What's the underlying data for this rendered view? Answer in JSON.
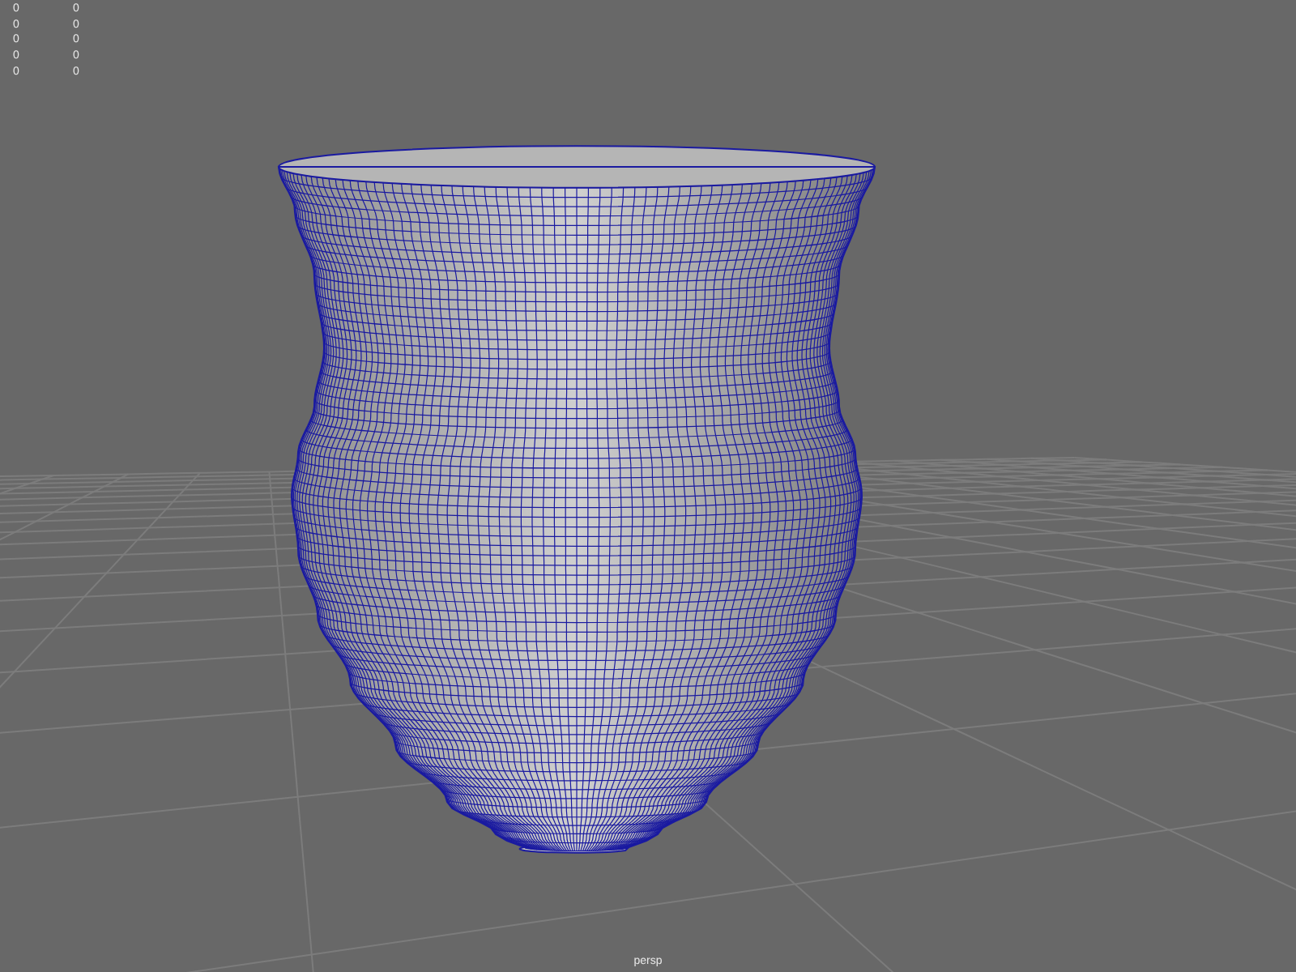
{
  "hud": {
    "rows": [
      {
        "column_1": "0",
        "column_2": "0"
      },
      {
        "column_1": "0",
        "column_2": "0"
      },
      {
        "column_1": "0",
        "column_2": "0"
      },
      {
        "column_1": "0",
        "column_2": "0"
      },
      {
        "column_1": "0",
        "column_2": "0"
      }
    ]
  },
  "camera_label": "persp"
}
